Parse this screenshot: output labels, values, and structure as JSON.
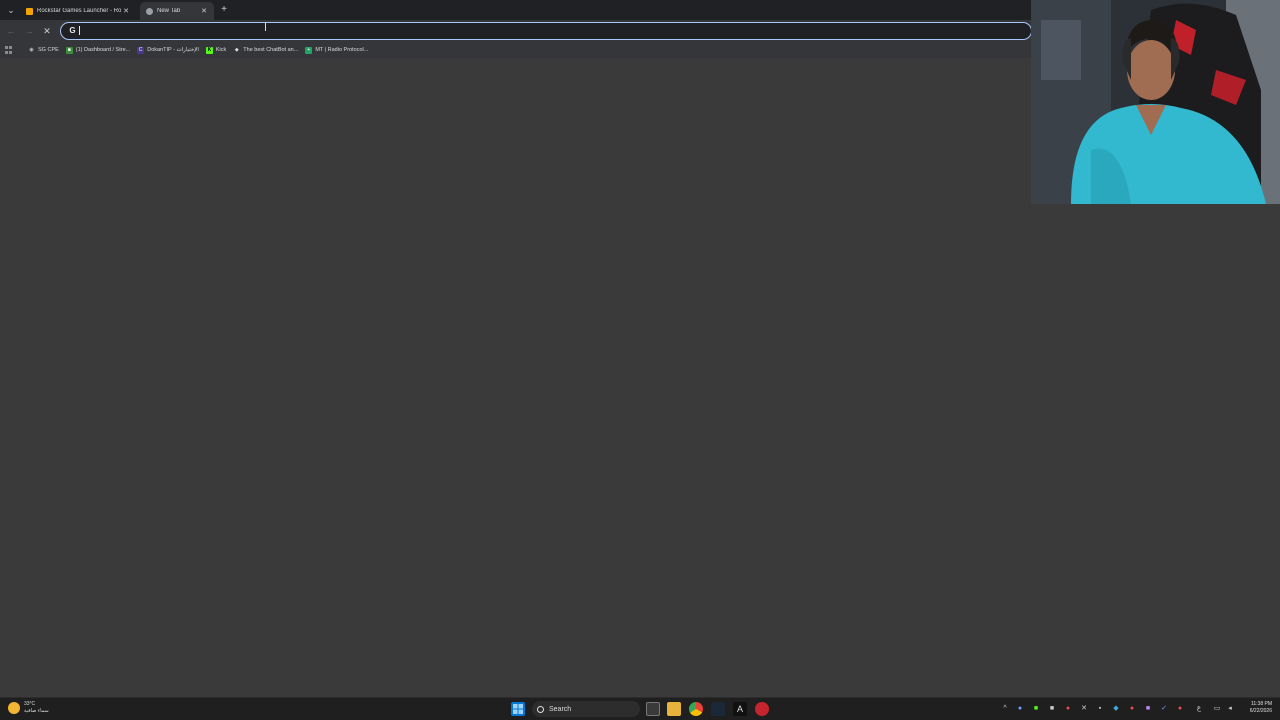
{
  "browser": {
    "tabs": [
      {
        "title": "Rockstar Games Launcher - Ro",
        "active": false,
        "favicon_color": "#f4a300"
      },
      {
        "title": "New Tab",
        "active": true,
        "favicon_color": "#9aa0a6"
      }
    ],
    "omnibox": {
      "value": "",
      "placeholder": ""
    },
    "bookmarks": [
      {
        "label": "SG CPE",
        "icon": "globe-icon",
        "color": "#5f6368",
        "glyph": "◉"
      },
      {
        "label": "(1) Dashboard / Stre...",
        "icon": "dashboard-icon",
        "color": "#3c8d3c",
        "glyph": "■"
      },
      {
        "label": "DokanTIP - الإختيارات",
        "icon": "dokantip-icon",
        "color": "#4b3a8a",
        "glyph": "C"
      },
      {
        "label": "Kick",
        "icon": "kick-icon",
        "color": "#53fc18",
        "glyph": "K"
      },
      {
        "label": "The best ChatBot an...",
        "icon": "chatbot-icon",
        "color": "#cccccc",
        "glyph": "◆"
      },
      {
        "label": "MT | Radio Protocol...",
        "icon": "sheets-icon",
        "color": "#1fa463",
        "glyph": "+"
      }
    ]
  },
  "taskbar": {
    "weather": {
      "temp": "33°C",
      "condition": "سماء صافية"
    },
    "search_label": "Search",
    "clock": {
      "time": "11:38 PM",
      "date": "6/22/2026"
    },
    "lang": "ع"
  },
  "colors": {
    "accent": "#a8c7fa",
    "background": "#3a3a3a",
    "tabstrip": "#202124"
  }
}
